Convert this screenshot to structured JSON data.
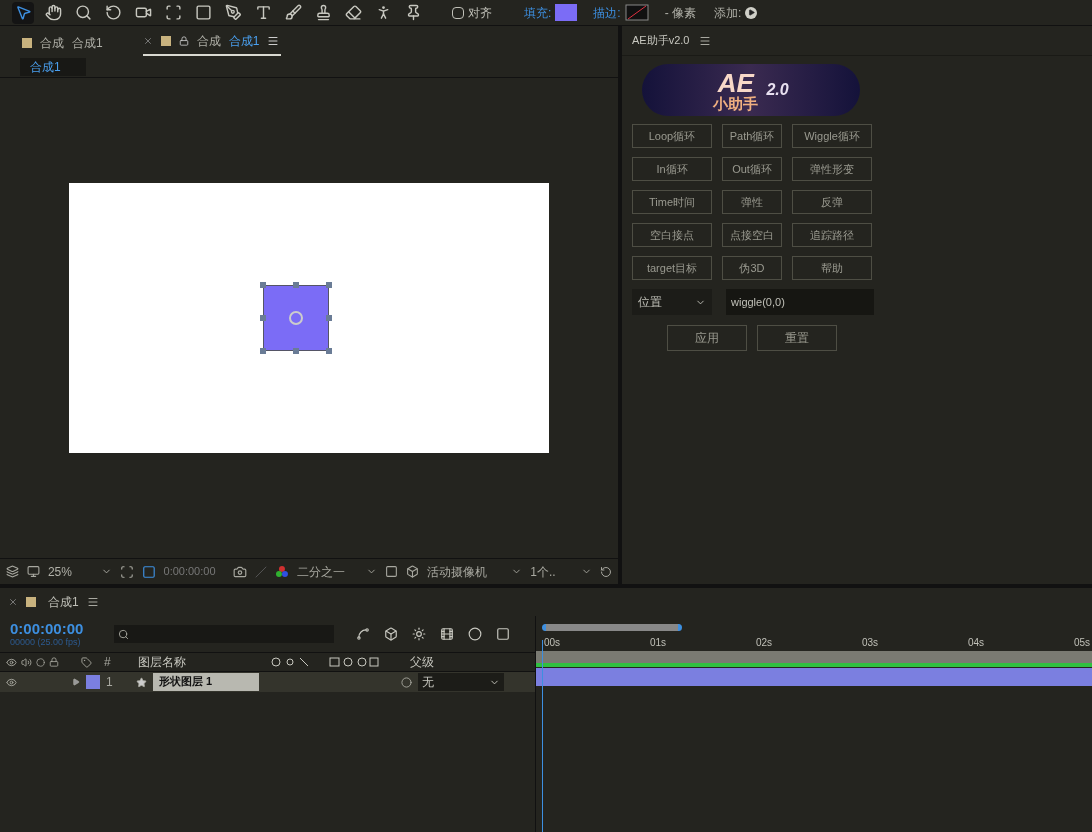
{
  "toolbar": {
    "tools": [
      {
        "kind": "select",
        "selected": true
      },
      {
        "kind": "hand",
        "selected": false
      },
      {
        "kind": "zoom",
        "selected": false
      },
      {
        "kind": "rotate",
        "selected": false
      },
      {
        "kind": "camera",
        "selected": false
      },
      {
        "kind": "anchor",
        "selected": false
      },
      {
        "kind": "rect",
        "selected": false
      },
      {
        "kind": "pen",
        "selected": false
      },
      {
        "kind": "type",
        "selected": false
      },
      {
        "kind": "brush",
        "selected": false
      },
      {
        "kind": "stamp",
        "selected": false
      },
      {
        "kind": "eraser",
        "selected": false
      },
      {
        "kind": "roto",
        "selected": false
      },
      {
        "kind": "pin",
        "selected": false
      }
    ],
    "align": {
      "label": "对齐",
      "checked": false
    },
    "fill": {
      "label": "填充:",
      "color": "#7b6cf6"
    },
    "stroke": {
      "label": "描边:"
    },
    "stroke_width": "- 像素",
    "add": {
      "label": "添加:"
    }
  },
  "comp_panel": {
    "tabs": [
      {
        "prefix": "合成",
        "name": "合成1",
        "selected": false
      },
      {
        "prefix": "合成",
        "name": "合成1",
        "selected": true
      }
    ],
    "breadcrumb": "合成1",
    "zoom": "25%",
    "timecode": "0:00:00:00",
    "resolution": "二分之一",
    "camera": "活动摄像机",
    "views": "1个.."
  },
  "helper_panel": {
    "title": "AE助手v2.0",
    "logo": {
      "line1": "AE",
      "line2": "小助手",
      "badge": "2.0"
    },
    "buttons": [
      "Loop循环",
      "Path循环",
      "Wiggle循环",
      "In循环",
      "Out循环",
      "弹性形变",
      "Time时间",
      "弹性",
      "反弹",
      "空白接点",
      "点接空白",
      "追踪路径",
      "target目标",
      "伪3D",
      "帮助"
    ],
    "property": "位置",
    "expression": "wiggle(0,0)",
    "actions": [
      "应用",
      "重置"
    ]
  },
  "timeline": {
    "tab": "合成1",
    "timecode": "0:00:00:00",
    "frame_info": "00000 (25.00 fps)",
    "columns": [
      "#",
      "图层名称",
      "父级"
    ],
    "layers": [
      {
        "number": "1",
        "name": "形状图层 1",
        "parent": "无",
        "color": "#7b7fe0",
        "visible": true,
        "selected": true
      }
    ],
    "ruler": [
      "00s",
      "01s",
      "02s",
      "03s",
      "04s",
      "05s"
    ]
  }
}
